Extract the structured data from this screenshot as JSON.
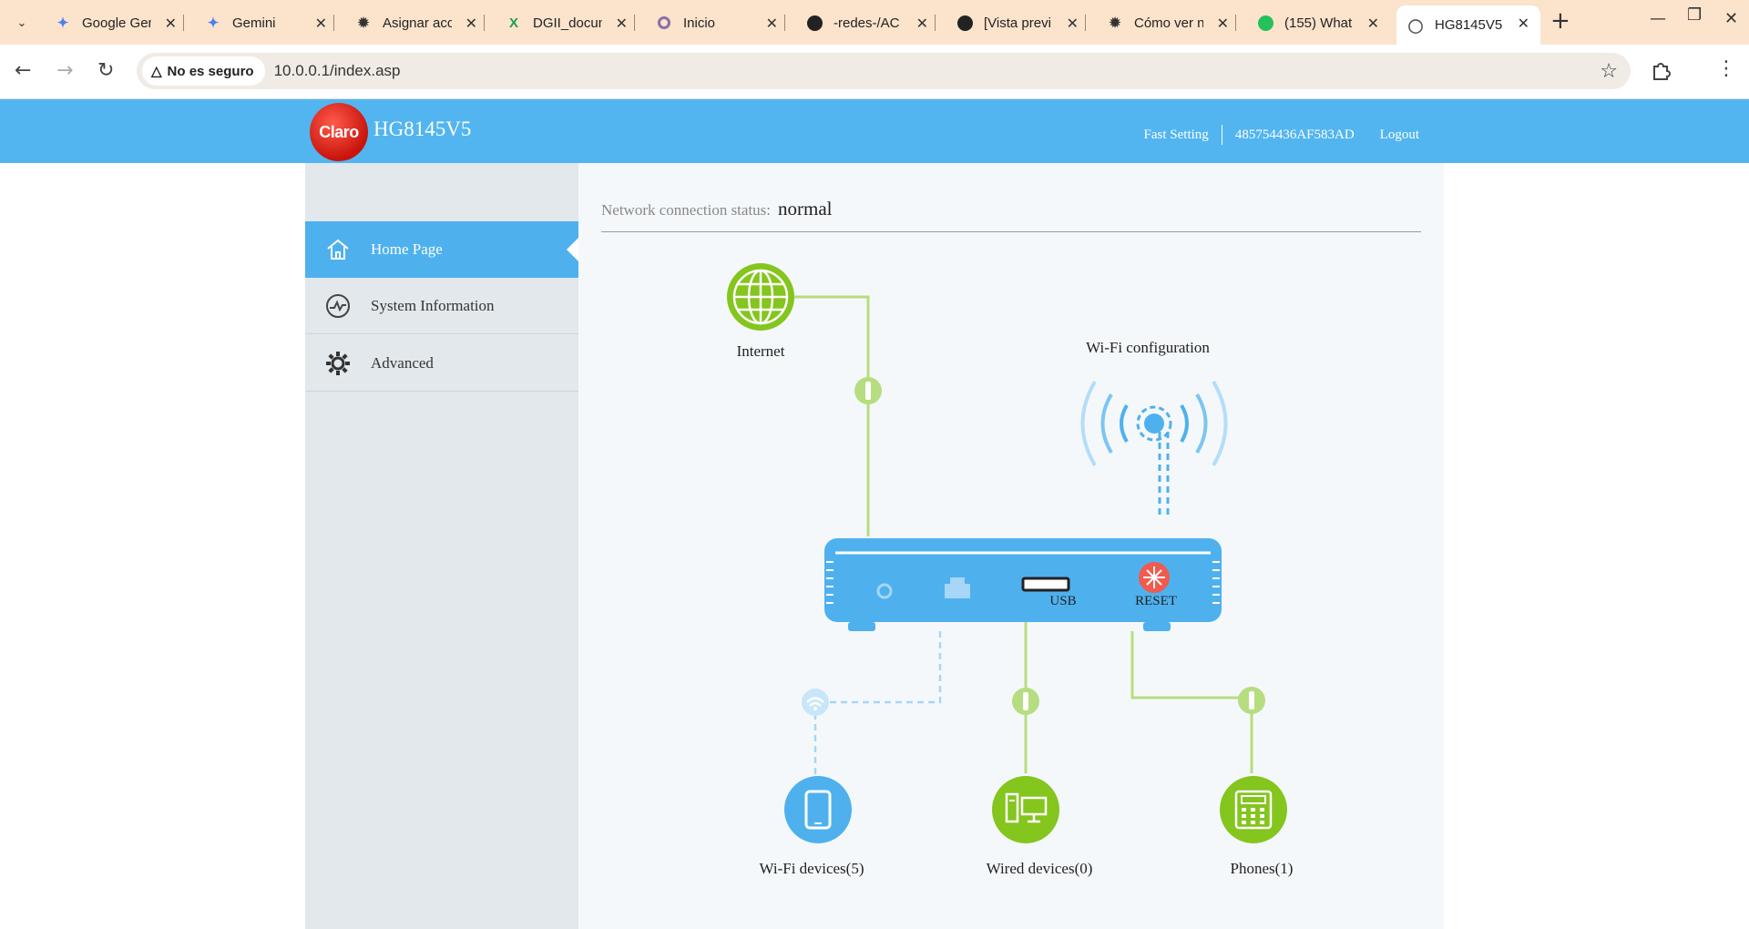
{
  "browser": {
    "tabs": [
      {
        "title": "Google Gem",
        "icon": "gemini-icon"
      },
      {
        "title": "Gemini",
        "icon": "gemini-icon"
      },
      {
        "title": "Asignar acc",
        "icon": "openai-icon"
      },
      {
        "title": "DGII_docum",
        "icon": "excel-icon"
      },
      {
        "title": "Inicio",
        "icon": "circle-icon"
      },
      {
        "title": "-redes-/AC",
        "icon": "github-icon"
      },
      {
        "title": "[Vista previ",
        "icon": "github-icon"
      },
      {
        "title": "Cómo ver n",
        "icon": "openai-icon"
      },
      {
        "title": "(155) What",
        "icon": "whatsapp-icon"
      },
      {
        "title": "HG8145V5",
        "icon": "globe-icon"
      }
    ],
    "security_chip": "No es seguro",
    "url": "10.0.0.1/index.asp"
  },
  "header": {
    "logo_text": "Claro",
    "model": "HG8145V5",
    "links": {
      "fast_setting": "Fast Setting",
      "serial": "485754436AF583AD",
      "logout": "Logout"
    }
  },
  "sidebar": {
    "items": [
      {
        "label": "Home Page",
        "icon": "home-icon",
        "active": true
      },
      {
        "label": "System Information",
        "icon": "activity-icon",
        "active": false
      },
      {
        "label": "Advanced",
        "icon": "gear-icon",
        "active": false
      }
    ]
  },
  "status": {
    "label": "Network connection status:",
    "value": "normal"
  },
  "diagram": {
    "internet": "Internet",
    "wifi_config": "Wi-Fi configuration",
    "usb": "USB",
    "reset": "RESET",
    "wifi_devices": "Wi-Fi devices(5)",
    "wired_devices": "Wired devices(0)",
    "phones": "Phones(1)",
    "colors": {
      "green": "#84c51e",
      "blue": "#4eb1ee",
      "light_green": "#b6dd80"
    }
  }
}
